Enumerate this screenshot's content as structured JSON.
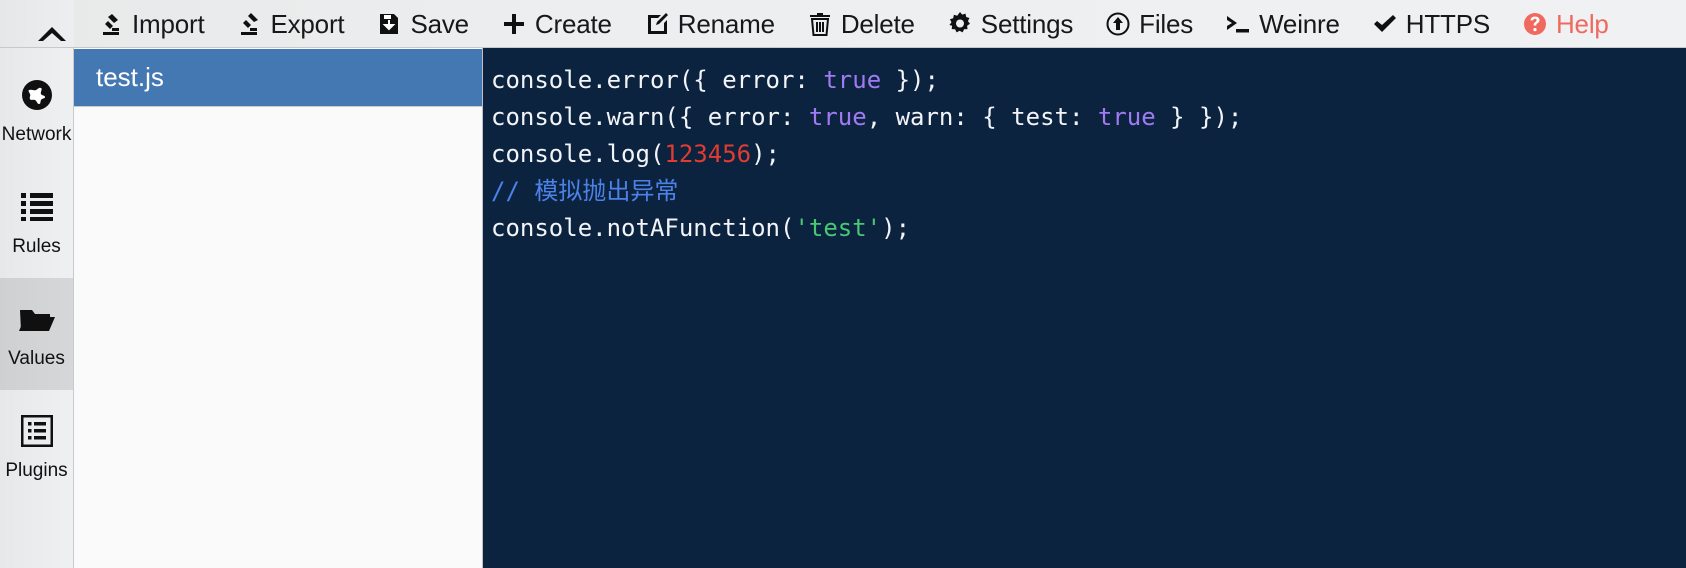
{
  "toolbar": {
    "collapse_icon": "chevron-up-icon",
    "items": [
      {
        "label": "Import",
        "icon": "import-icon"
      },
      {
        "label": "Export",
        "icon": "export-icon"
      },
      {
        "label": "Save",
        "icon": "save-disk-icon"
      },
      {
        "label": "Create",
        "icon": "plus-icon"
      },
      {
        "label": "Rename",
        "icon": "edit-square-icon"
      },
      {
        "label": "Delete",
        "icon": "trash-icon"
      },
      {
        "label": "Settings",
        "icon": "gear-icon"
      },
      {
        "label": "Files",
        "icon": "upload-circle-icon"
      },
      {
        "label": "Weinre",
        "icon": "terminal-prompt-icon"
      },
      {
        "label": "HTTPS",
        "icon": "check-icon"
      },
      {
        "label": "Help",
        "icon": "question-circle-icon"
      }
    ]
  },
  "sidebar": {
    "items": [
      {
        "label": "Network",
        "icon": "globe-icon",
        "active": false
      },
      {
        "label": "Rules",
        "icon": "list-icon",
        "active": false
      },
      {
        "label": "Values",
        "icon": "folder-open-icon",
        "active": true
      },
      {
        "label": "Plugins",
        "icon": "list-box-icon",
        "active": false
      }
    ]
  },
  "filelist": {
    "files": [
      {
        "name": "test.js",
        "selected": true
      }
    ]
  },
  "editor": {
    "language": "javascript",
    "background": "#0c2340",
    "lines": [
      [
        {
          "t": "console.error({ error: ",
          "c": "plain"
        },
        {
          "t": "true",
          "c": "bool"
        },
        {
          "t": " });",
          "c": "plain"
        }
      ],
      [
        {
          "t": "console.warn({ error: ",
          "c": "plain"
        },
        {
          "t": "true",
          "c": "bool"
        },
        {
          "t": ", warn: { test: ",
          "c": "plain"
        },
        {
          "t": "true",
          "c": "bool"
        },
        {
          "t": " } });",
          "c": "plain"
        }
      ],
      [
        {
          "t": "console.log(",
          "c": "plain"
        },
        {
          "t": "123456",
          "c": "num"
        },
        {
          "t": ");",
          "c": "plain"
        }
      ],
      [
        {
          "t": "// 模拟抛出异常",
          "c": "comment"
        }
      ],
      [
        {
          "t": "console.notAFunction(",
          "c": "plain"
        },
        {
          "t": "'test'",
          "c": "str"
        },
        {
          "t": ");",
          "c": "plain"
        }
      ]
    ]
  },
  "colors": {
    "editor_bg": "#0c2340",
    "selection_blue": "#4478b3",
    "help_red": "#f0695f",
    "keyword_purple": "#a07af0",
    "number_red": "#e03c31",
    "string_green": "#48c774",
    "comment_blue": "#4c82e8"
  }
}
